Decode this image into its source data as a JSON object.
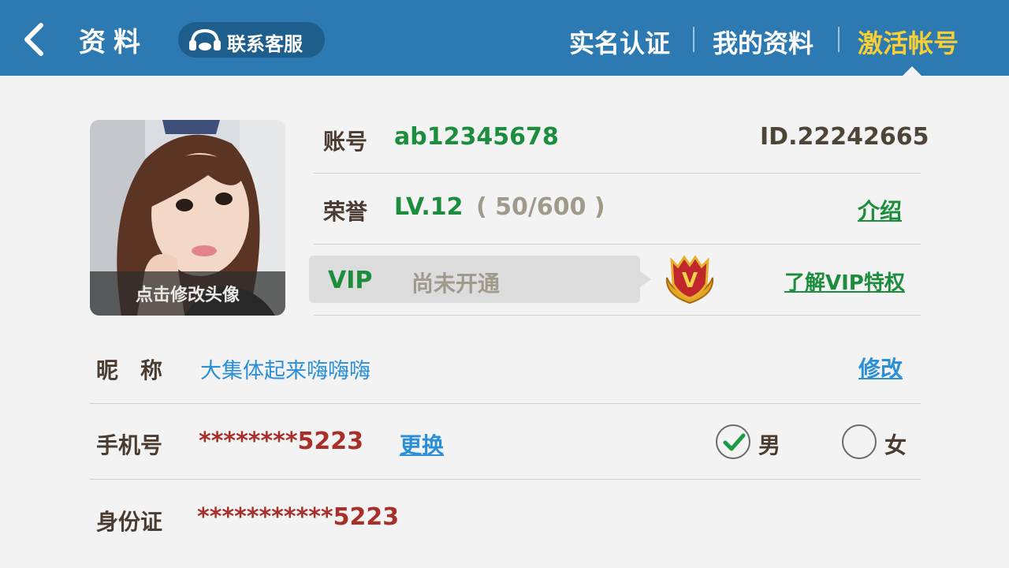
{
  "header": {
    "title": "资料",
    "support_label": "联系客服",
    "tabs": [
      {
        "label": "实名认证",
        "active": false
      },
      {
        "label": "我的资料",
        "active": false
      },
      {
        "label": "激活帐号",
        "active": true
      }
    ],
    "accent_color": "#2c7ab1",
    "active_tab_color": "#f7cf34"
  },
  "avatar": {
    "caption": "点击修改头像"
  },
  "account": {
    "label": "账号",
    "value": "ab12345678",
    "id": "ID.22242665"
  },
  "honor": {
    "label": "荣誉",
    "level": "LV.12",
    "progress": "( 50/600 )",
    "link": "介绍"
  },
  "vip": {
    "label": "VIP",
    "status": "尚未开通",
    "badge_letter": "V",
    "link": "了解VIP特权"
  },
  "nickname": {
    "label": "昵　称",
    "value": "大集体起来嗨嗨嗨",
    "link": "修改"
  },
  "phone": {
    "label": "手机号",
    "value": "********5223",
    "link": "更换"
  },
  "gender": {
    "male": "男",
    "female": "女",
    "selected": "男"
  },
  "id_card": {
    "label": "身份证",
    "value": "***********5223"
  }
}
